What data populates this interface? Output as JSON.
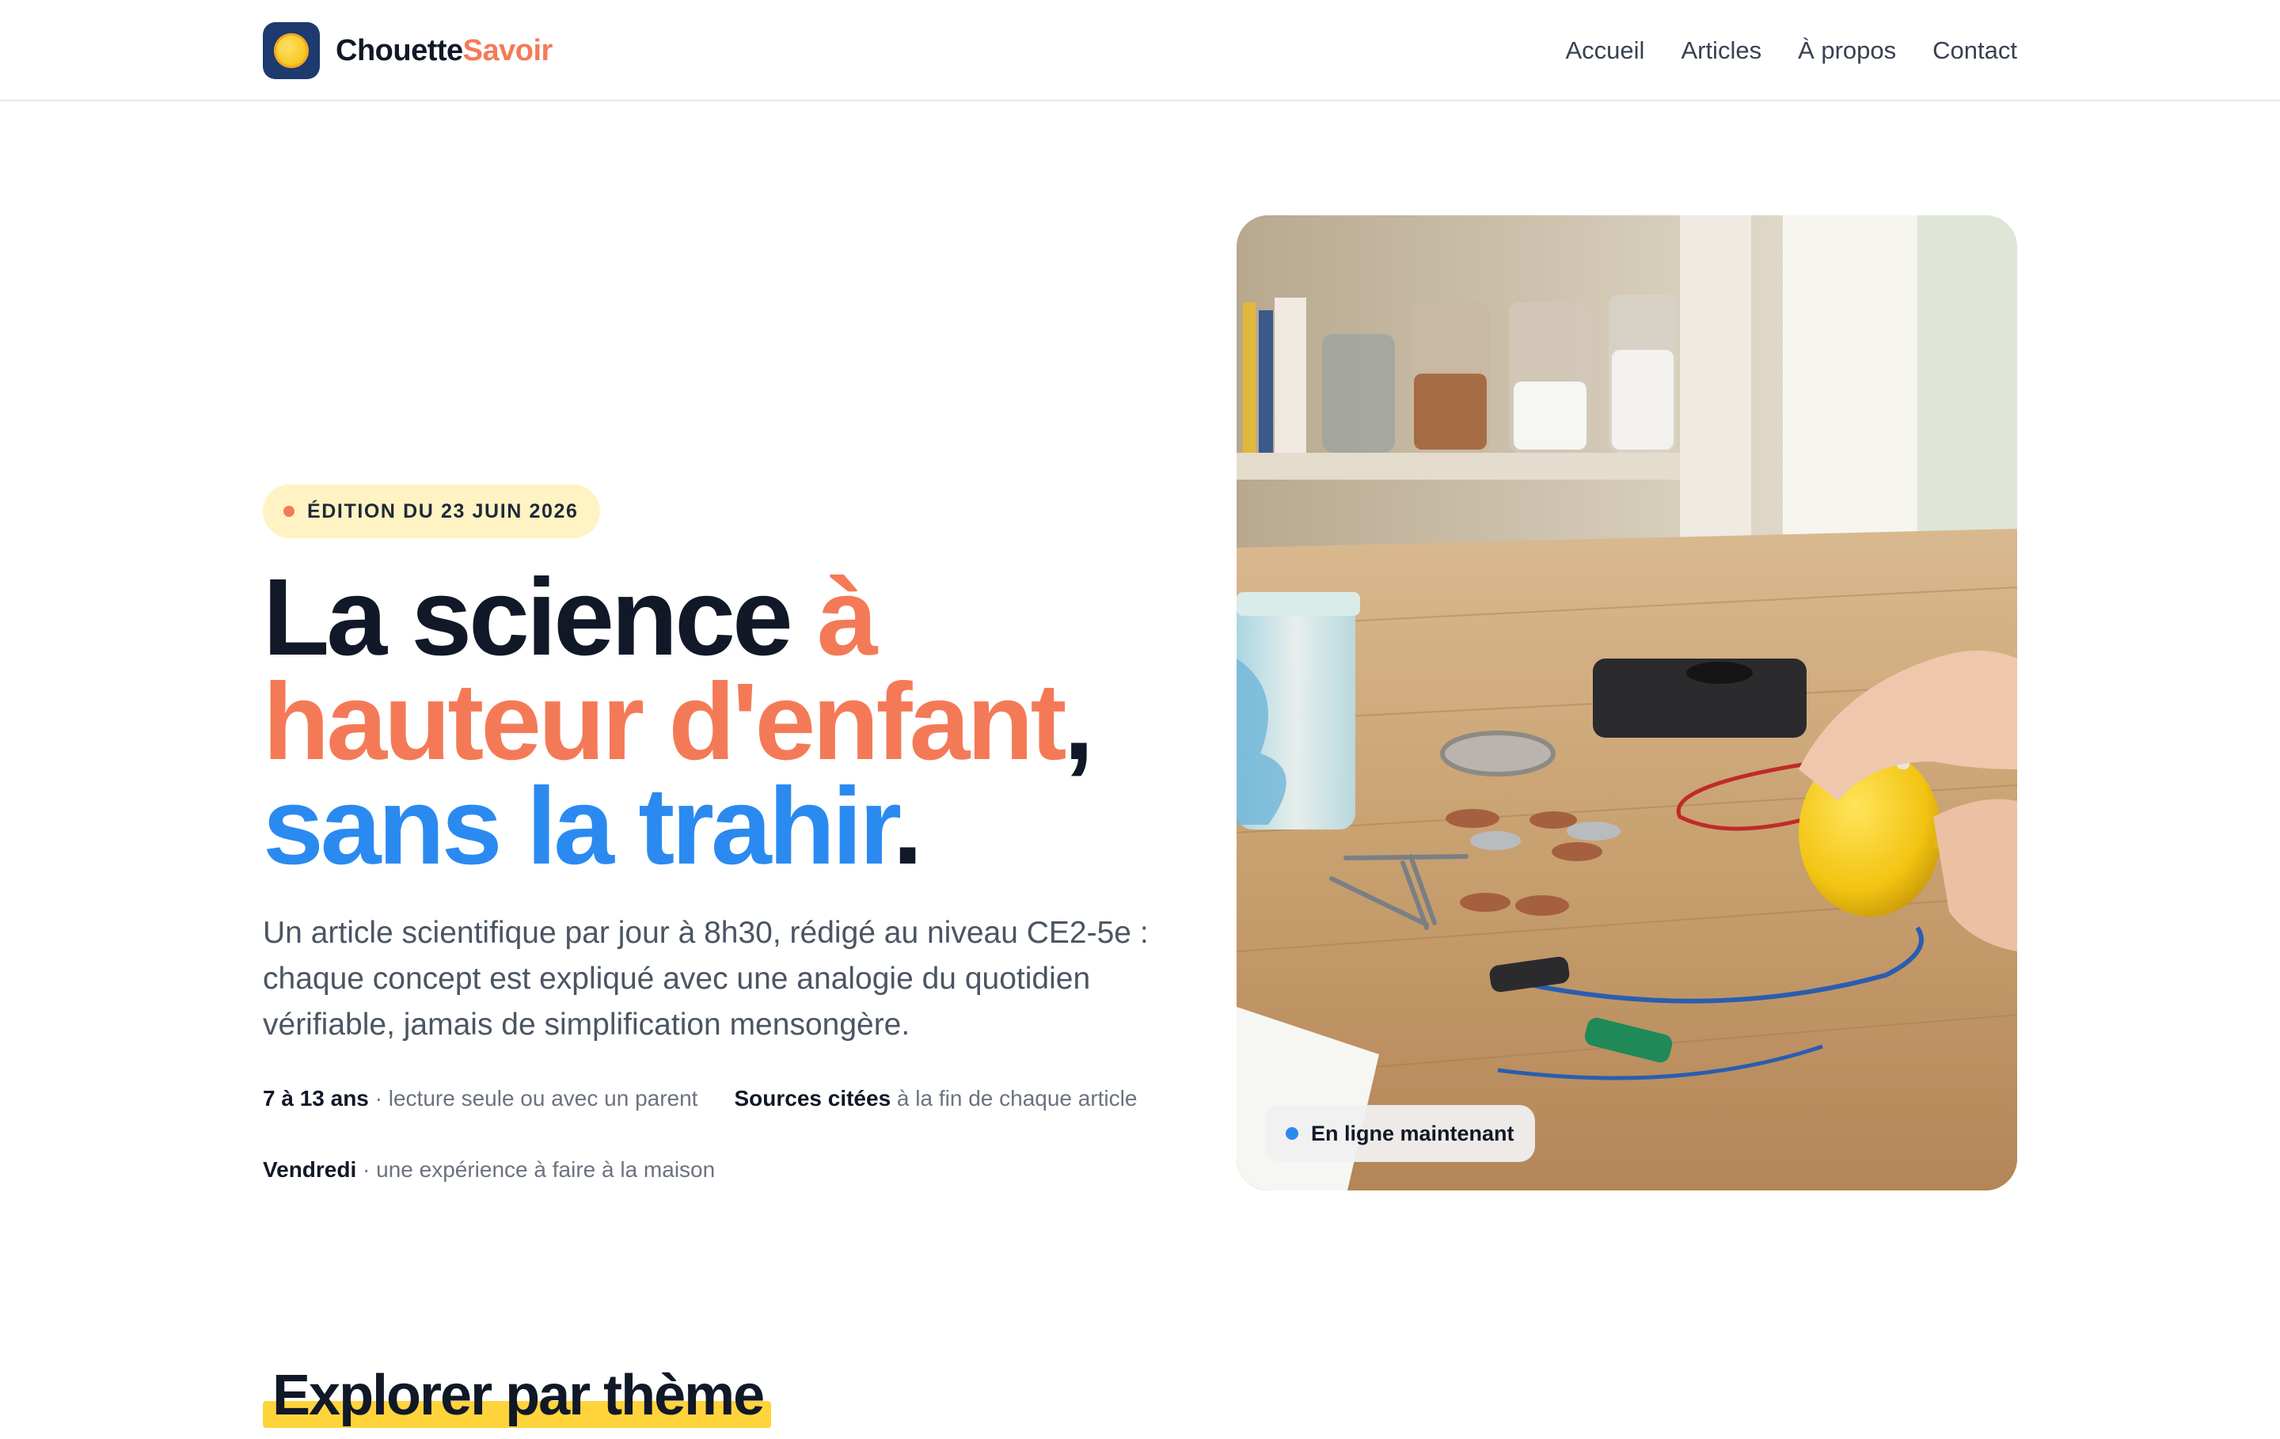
{
  "brand": {
    "name_part1": "Chouette",
    "name_part2": "Savoir"
  },
  "nav": {
    "items": [
      "Accueil",
      "Articles",
      "À propos",
      "Contact"
    ]
  },
  "hero": {
    "badge": "ÉDITION DU 23 JUIN 2026",
    "headline": {
      "part1": "La science ",
      "part2": "à hauteur d'enfant",
      "part3": ",",
      "part4": "sans la trahir",
      "part5": "."
    },
    "lede": "Un article scientifique par jour à 8h30, rédigé au niveau CE2-5e : chaque concept est expliqué avec une analogie du quotidien vérifiable, jamais de simplification mensongère.",
    "meta": [
      {
        "strong": "7 à 13 ans",
        "detail": " · lecture seule ou avec un parent"
      },
      {
        "strong": "Sources citées",
        "detail": " à la fin de chaque article"
      },
      {
        "strong": "Vendredi",
        "detail": " · une expérience à faire à la maison"
      }
    ],
    "status_badge": "En ligne maintenant"
  },
  "section": {
    "title": "Explorer par thème"
  },
  "colors": {
    "accent_coral": "#f47a57",
    "accent_blue": "#2b8af0",
    "badge_bg": "#fff3c4",
    "highlight": "#ffd43b",
    "logo_bg": "#1e3a6e"
  }
}
